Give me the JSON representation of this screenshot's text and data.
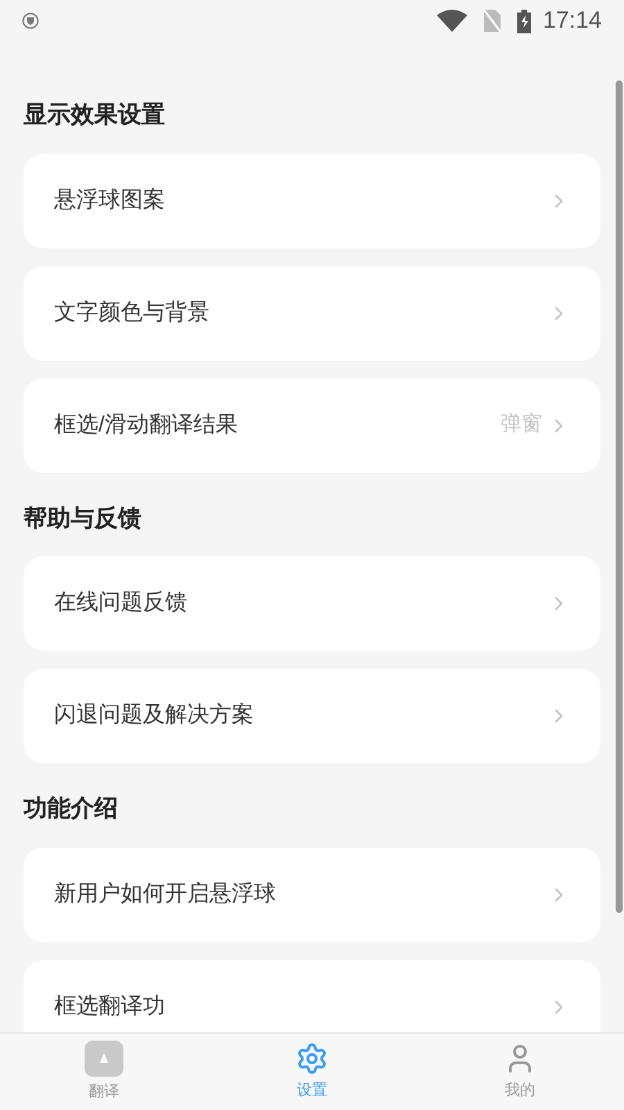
{
  "status_bar": {
    "time": "17:14"
  },
  "sections": [
    {
      "title": "显示效果设置",
      "items": [
        {
          "label": "悬浮球图案"
        },
        {
          "label": "文字颜色与背景"
        },
        {
          "label": "框选/滑动翻译结果",
          "value": "弹窗"
        }
      ]
    },
    {
      "title": "帮助与反馈",
      "items": [
        {
          "label": "在线问题反馈"
        },
        {
          "label": "闪退问题及解决方案"
        }
      ]
    },
    {
      "title": "功能介绍",
      "items": [
        {
          "label": "新用户如何开启悬浮球"
        },
        {
          "label": "框选翻译功"
        }
      ]
    }
  ],
  "bottom_nav": [
    {
      "label": "翻译",
      "selected": false
    },
    {
      "label": "设置",
      "selected": true
    },
    {
      "label": "我的",
      "selected": false
    }
  ]
}
